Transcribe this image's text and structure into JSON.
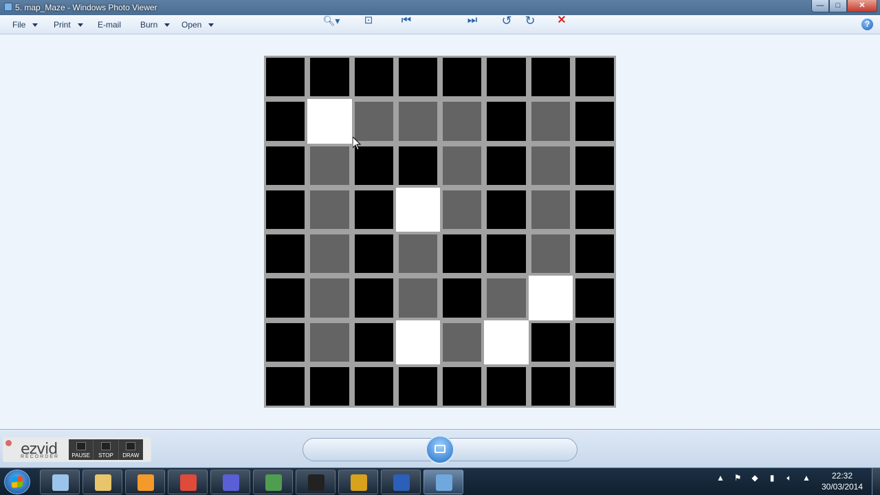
{
  "window": {
    "title": "5. map_Maze - Windows Photo Viewer",
    "buttons": {
      "minimize": "—",
      "maximize": "□",
      "close": "✕"
    }
  },
  "menu": {
    "items": [
      {
        "label": "File",
        "has_dropdown": true
      },
      {
        "label": "Print",
        "has_dropdown": true
      },
      {
        "label": "E-mail",
        "has_dropdown": false
      },
      {
        "label": "Burn",
        "has_dropdown": true
      },
      {
        "label": "Open",
        "has_dropdown": true
      }
    ],
    "help": "?"
  },
  "image": {
    "grid_size": 8,
    "legend": {
      "wall": "black",
      "path": "gray",
      "goal": "white"
    },
    "cells": [
      [
        "wall",
        "wall",
        "wall",
        "wall",
        "wall",
        "wall",
        "wall",
        "wall"
      ],
      [
        "wall",
        "goal",
        "path",
        "path",
        "path",
        "wall",
        "path",
        "wall"
      ],
      [
        "wall",
        "path",
        "wall",
        "wall",
        "path",
        "wall",
        "path",
        "wall"
      ],
      [
        "wall",
        "path",
        "wall",
        "goal",
        "path",
        "wall",
        "path",
        "wall"
      ],
      [
        "wall",
        "path",
        "wall",
        "path",
        "wall",
        "wall",
        "path",
        "wall"
      ],
      [
        "wall",
        "path",
        "wall",
        "path",
        "wall",
        "path",
        "goal",
        "wall"
      ],
      [
        "wall",
        "path",
        "wall",
        "goal",
        "path",
        "goal",
        "wall",
        "wall"
      ],
      [
        "wall",
        "wall",
        "wall",
        "wall",
        "wall",
        "wall",
        "wall",
        "wall"
      ]
    ],
    "colors": {
      "wall": "#000000",
      "path": "#646464",
      "goal": "#ffffff",
      "border": "#a2a2a2"
    }
  },
  "controls": [
    {
      "name": "zoom-icon",
      "glyph": "🔍︎▾"
    },
    {
      "name": "fit-window-icon",
      "glyph": "⊡"
    },
    {
      "name": "previous-icon",
      "glyph": "⏮"
    },
    {
      "name": "next-icon",
      "glyph": "⏭"
    },
    {
      "name": "rotate-counterclockwise-icon",
      "glyph": "↺"
    },
    {
      "name": "rotate-clockwise-icon",
      "glyph": "↻"
    },
    {
      "name": "delete-icon",
      "glyph": "✕"
    }
  ],
  "ezvid": {
    "logo": "ezvid",
    "subtitle": "RECORDER",
    "tools": [
      "PAUSE",
      "STOP",
      "DRAW"
    ]
  },
  "taskbar": {
    "apps": [
      {
        "name": "calculator-icon",
        "color": "#9cc4ea"
      },
      {
        "name": "file-explorer-icon",
        "color": "#e8c56a"
      },
      {
        "name": "media-player-icon",
        "color": "#f39a2a"
      },
      {
        "name": "chrome-icon",
        "color": "#e04a3b"
      },
      {
        "name": "infinity-app-icon",
        "color": "#5a5fd6"
      },
      {
        "name": "monitor-app-icon",
        "color": "#4f9d4f"
      },
      {
        "name": "udk-icon",
        "color": "#222222"
      },
      {
        "name": "pattern-app-icon",
        "color": "#d8a21c"
      },
      {
        "name": "word-icon",
        "color": "#2b5fb8"
      },
      {
        "name": "photo-viewer-icon",
        "color": "#6fa8dc"
      }
    ],
    "clock": {
      "time": "22:32",
      "date": "30/03/2014"
    }
  }
}
